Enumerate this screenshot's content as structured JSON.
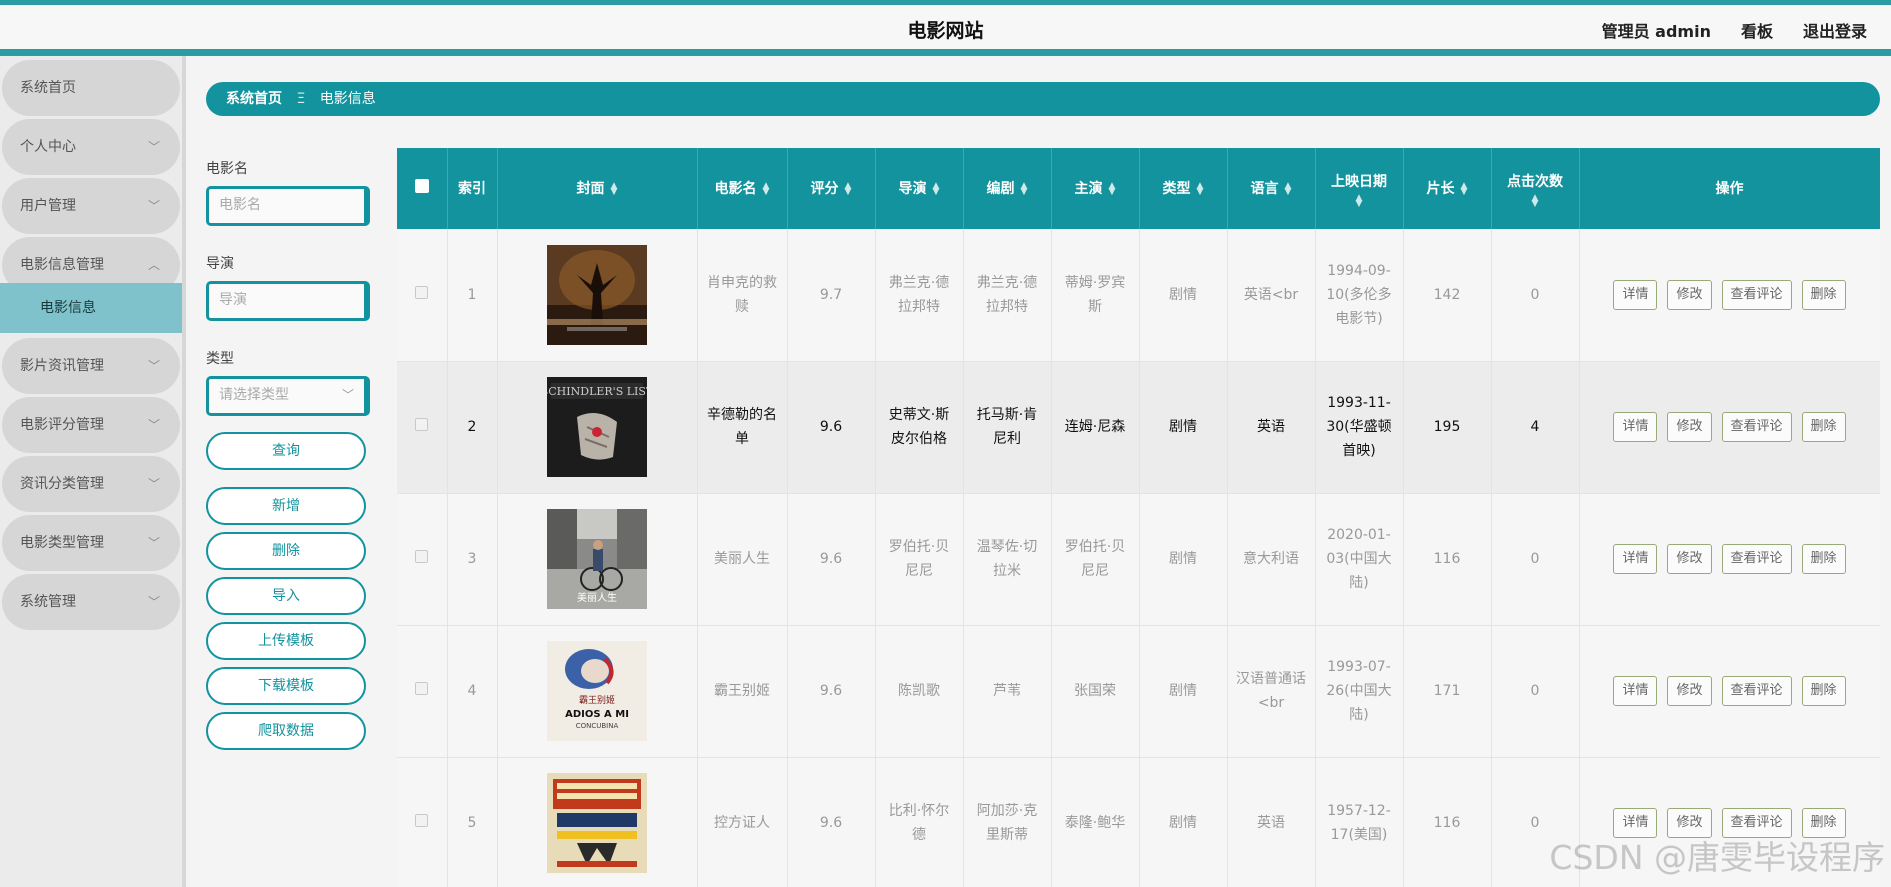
{
  "header": {
    "title": "电影网站",
    "admin_label": "管理员 admin",
    "dashboard_label": "看板",
    "logout_label": "退出登录"
  },
  "sidebar": {
    "items": [
      {
        "label": "系统首页",
        "chevron": ""
      },
      {
        "label": "个人中心",
        "chevron": "﹀"
      },
      {
        "label": "用户管理",
        "chevron": "﹀"
      },
      {
        "label": "电影信息管理",
        "chevron": "︿"
      },
      {
        "label": "影片资讯管理",
        "chevron": "﹀"
      },
      {
        "label": "电影评分管理",
        "chevron": "﹀"
      },
      {
        "label": "资讯分类管理",
        "chevron": "﹀"
      },
      {
        "label": "电影类型管理",
        "chevron": "﹀"
      },
      {
        "label": "系统管理",
        "chevron": "﹀"
      }
    ],
    "active_sub": "电影信息"
  },
  "breadcrumb": {
    "home": "系统首页",
    "separator": "Ξ",
    "current": "电影信息"
  },
  "filters": {
    "movie_label": "电影名",
    "movie_placeholder": "电影名",
    "director_label": "导演",
    "director_placeholder": "导演",
    "type_label": "类型",
    "type_placeholder": "请选择类型",
    "buttons": {
      "query": "查询",
      "add": "新增",
      "delete": "删除",
      "import": "导入",
      "upload_template": "上传模板",
      "download_template": "下载模板",
      "crawl": "爬取数据"
    }
  },
  "table": {
    "headers": {
      "index": "索引",
      "cover": "封面",
      "name": "电影名",
      "score": "评分",
      "director": "导演",
      "writer": "编剧",
      "star": "主演",
      "type": "类型",
      "language": "语言",
      "release": "上映日期",
      "length": "片长",
      "clicks": "点击次数",
      "ops": "操作"
    },
    "op_labels": {
      "detail": "详情",
      "edit": "修改",
      "comments": "查看评论",
      "delete": "删除"
    },
    "rows": [
      {
        "index": "1",
        "name": "肖申克的救赎",
        "score": "9.7",
        "director": "弗兰克·德拉邦特",
        "writer": "弗兰克·德拉邦特",
        "star": "蒂姆·罗宾斯",
        "type": "剧情",
        "language": "英语<br",
        "release": "1994-09-10(多伦多电影节)",
        "length": "142",
        "clicks": "0"
      },
      {
        "index": "2",
        "name": "辛德勒的名单",
        "score": "9.6",
        "director": "史蒂文·斯皮尔伯格",
        "writer": "托马斯·肯尼利",
        "star": "连姆·尼森",
        "type": "剧情",
        "language": "英语",
        "release": "1993-11-30(华盛顿首映)",
        "length": "195",
        "clicks": "4"
      },
      {
        "index": "3",
        "name": "美丽人生",
        "score": "9.6",
        "director": "罗伯托·贝尼尼",
        "writer": "温琴佐·切拉米",
        "star": "罗伯托·贝尼尼",
        "type": "剧情",
        "language": "意大利语",
        "release": "2020-01-03(中国大陆)",
        "length": "116",
        "clicks": "0"
      },
      {
        "index": "4",
        "name": "霸王别姬",
        "score": "9.6",
        "director": "陈凯歌",
        "writer": "芦苇",
        "star": "张国荣",
        "type": "剧情",
        "language": "汉语普通话<br",
        "release": "1993-07-26(中国大陆)",
        "length": "171",
        "clicks": "0"
      },
      {
        "index": "5",
        "name": "控方证人",
        "score": "9.6",
        "director": "比利·怀尔德",
        "writer": "阿加莎·克里斯蒂",
        "star": "泰隆·鲍华",
        "type": "剧情",
        "language": "英语",
        "release": "1957-12-17(美国)",
        "length": "116",
        "clicks": "0"
      }
    ]
  },
  "watermark": "CSDN @唐雯毕设程序",
  "colors": {
    "accent": "#13939d",
    "sidebar_active": "#7fc2cb",
    "menu_bg": "#d6d6d6"
  }
}
